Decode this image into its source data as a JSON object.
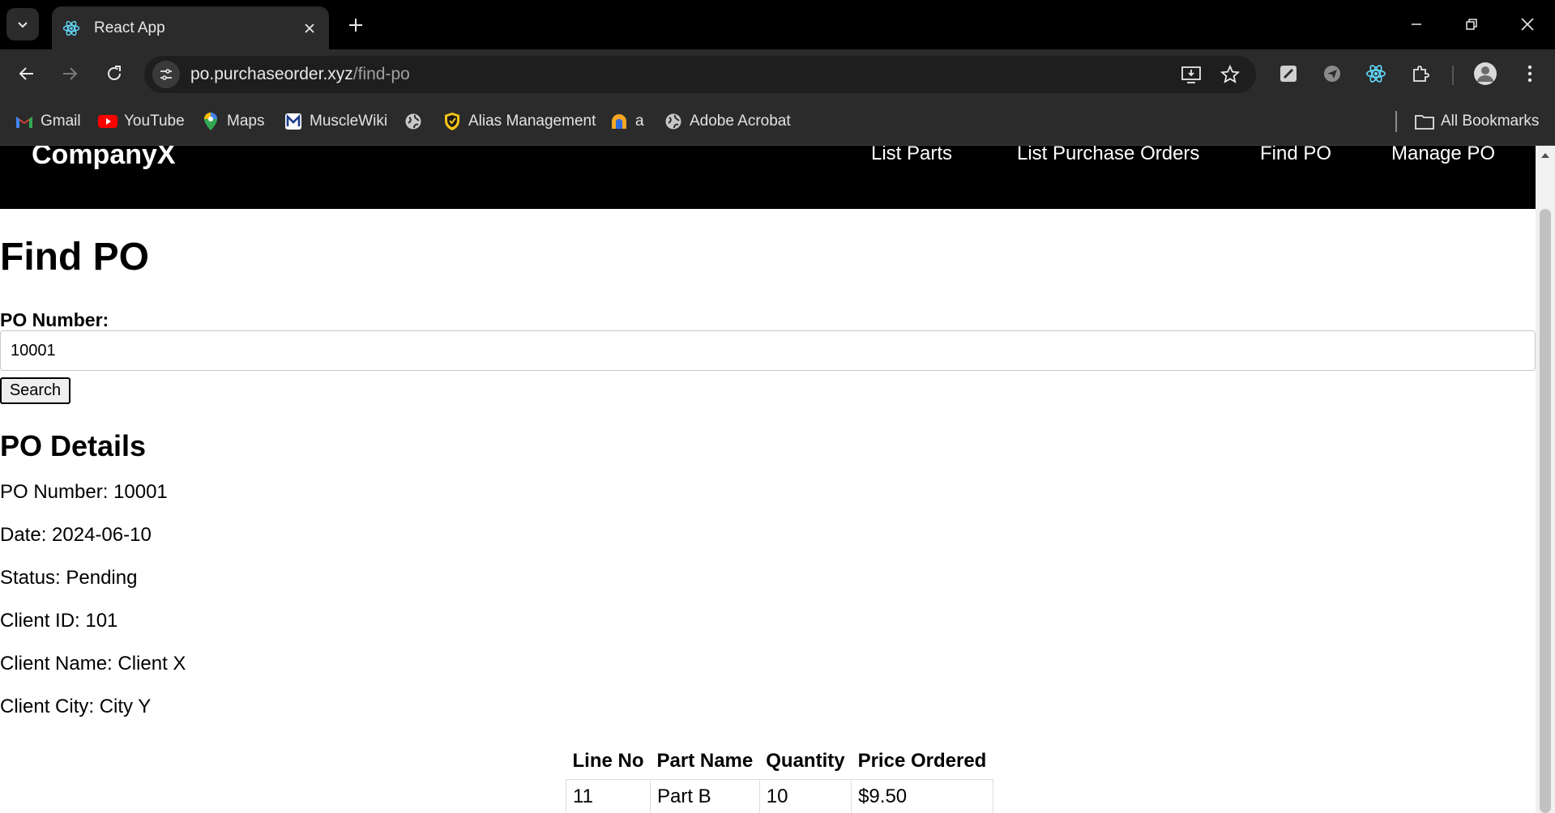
{
  "browser": {
    "tab_title": "React App",
    "url_host": "po.purchaseorder.xyz",
    "url_path": "/find-po",
    "bookmarks": [
      {
        "label": "Gmail",
        "icon": "gmail-icon"
      },
      {
        "label": "YouTube",
        "icon": "youtube-icon"
      },
      {
        "label": "Maps",
        "icon": "maps-icon"
      },
      {
        "label": "MuscleWiki",
        "icon": "musclewiki-icon"
      },
      {
        "label": "",
        "icon": "globe-icon"
      },
      {
        "label": "Alias Management",
        "icon": "shield-icon"
      },
      {
        "label": "a",
        "icon": "arch-icon"
      },
      {
        "label": "Adobe Acrobat",
        "icon": "globe-icon"
      }
    ],
    "all_bookmarks": "All Bookmarks"
  },
  "app": {
    "brand": "CompanyX",
    "nav": [
      "List Parts",
      "List Purchase Orders",
      "Find PO",
      "Manage PO"
    ]
  },
  "page": {
    "title": "Find PO",
    "po_label": "PO Number:",
    "po_value": "10001",
    "search_label": "Search",
    "details_title": "PO Details",
    "details": [
      "PO Number: 10001",
      "Date: 2024-06-10",
      "Status: Pending",
      "Client ID: 101",
      "Client Name: Client X",
      "Client City: City Y"
    ],
    "table": {
      "headers": [
        "Line No",
        "Part Name",
        "Quantity",
        "Price Ordered"
      ],
      "rows": [
        [
          "11",
          "Part B",
          "10",
          "$9.50"
        ]
      ]
    }
  },
  "colors": {
    "chrome_dark": "#000000",
    "chrome_toolbar": "#2b2b2b",
    "nav_bg": "#000000",
    "react_cyan": "#61dafb"
  }
}
